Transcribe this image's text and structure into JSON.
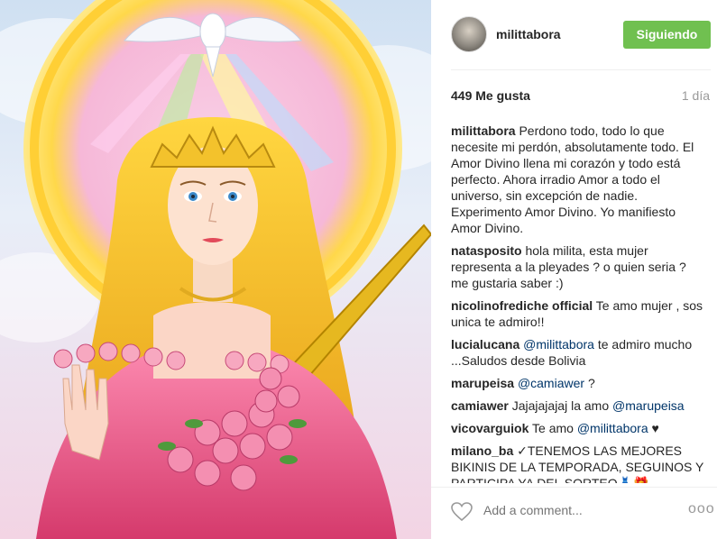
{
  "post": {
    "username": "milittabora",
    "follow_label": "Siguiendo",
    "likes": "449 Me gusta",
    "time": "1 día"
  },
  "comments": [
    {
      "user": "milittabora",
      "text": "Perdono todo, todo lo que necesite mi perdón, absolutamente todo. El Amor Divino llena mi corazón y todo está perfecto. Ahora irradio Amor a todo el universo, sin excepción de nadie. Experimento Amor Divino. Yo manifiesto Amor Divino."
    },
    {
      "user": "natasposito",
      "text": "hola milita, esta mujer representa a la pleyades ? o quien seria ? me gustaria saber :)"
    },
    {
      "user": "nicolinofrediche official",
      "text": "Te amo mujer , sos unica te admiro!!"
    },
    {
      "user": "lucialucana",
      "mention": "@milittabora",
      "text": "te admiro mucho ...Saludos desde Bolivia"
    },
    {
      "user": "marupeisa",
      "mention": "@camiawer",
      "text": "?"
    },
    {
      "user": "camiawer",
      "text": "Jajajajajaj la amo",
      "mention": "@marupeisa"
    },
    {
      "user": "vicovarguiok",
      "text": "Te amo",
      "mention": "@milittabora",
      "emoji": "♥"
    },
    {
      "user": "milano_ba",
      "text": "✓TENEMOS LAS MEJORES BIKINIS DE LA TEMPORADA, SEGUINOS Y PARTICIPA YA DEL SORTEO👗🎁"
    }
  ],
  "actions": {
    "add_comment_placeholder": "Add a comment...",
    "more_label": "ooo"
  },
  "colors": {
    "follow_green": "#70c050",
    "mention_blue": "#003569"
  },
  "icons": [
    "heart-icon",
    "more-options-icon"
  ]
}
